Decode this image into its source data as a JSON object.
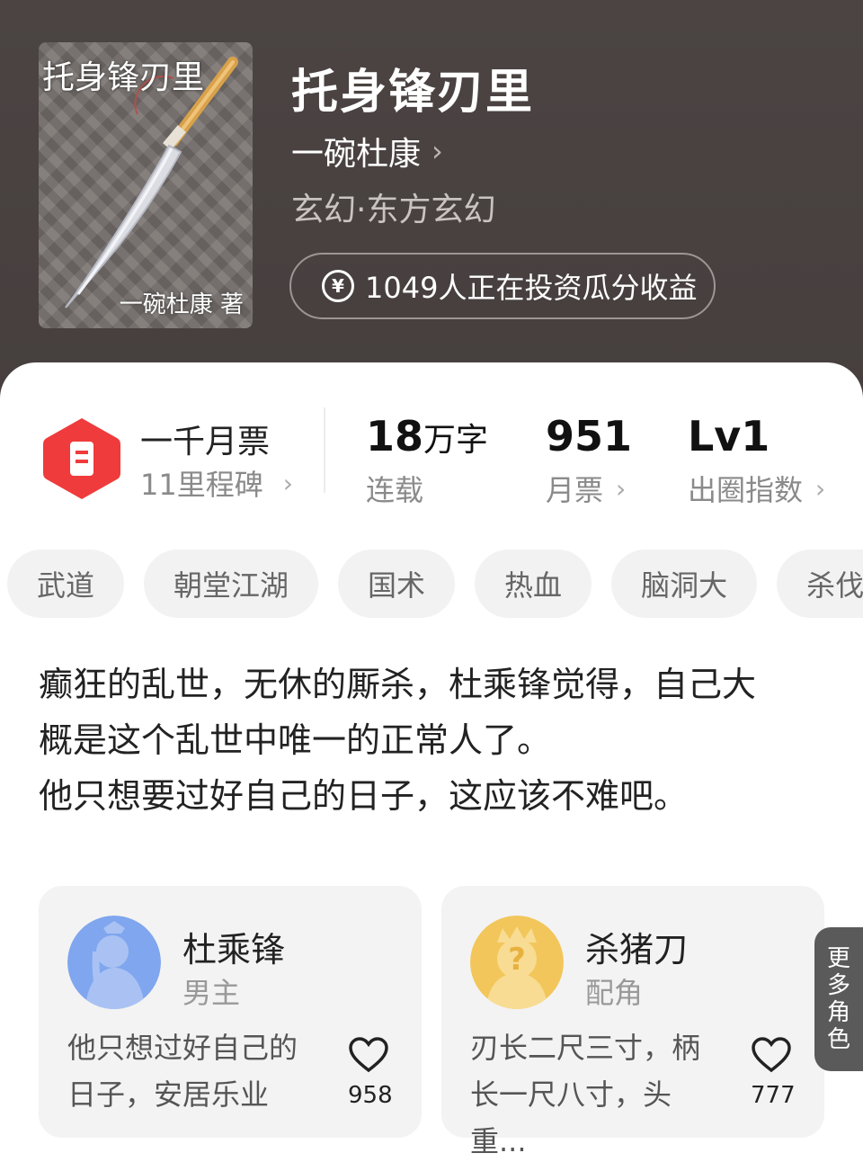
{
  "book": {
    "cover_title": "托身锋刃里",
    "cover_author": "一碗杜康 著",
    "title": "托身锋刃里",
    "author": "一碗杜康",
    "genre": "玄幻·东方玄幻",
    "invest_text": "1049人正在投资瓜分收益",
    "invest_icon": "yen-coin-icon"
  },
  "milestone": {
    "title": "一千月票",
    "sub": "11里程碑",
    "icon": "ticket-hexagon-icon",
    "color": "#ef3b3b"
  },
  "stats": [
    {
      "value": "18",
      "unit": "万字",
      "label": "连载"
    },
    {
      "value": "951",
      "unit": "",
      "label": "月票"
    },
    {
      "value": "Lv1",
      "unit": "",
      "label": "出圈指数"
    }
  ],
  "tags": [
    "武道",
    "朝堂江湖",
    "国术",
    "热血",
    "脑洞大",
    "杀伐果断"
  ],
  "description": [
    "癫狂的乱世，无休的厮杀，杜乘锋觉得，自己大",
    "概是这个乱世中唯一的正常人了。",
    "他只想要过好自己的日子，这应该不难吧。"
  ],
  "roles": [
    {
      "name": "杜乘锋",
      "tag": "男主",
      "desc_line1": "他只想过好自己的",
      "desc_line2": "日子，安居乐业",
      "likes": "958",
      "avatar_color": "#7fa6ee"
    },
    {
      "name": "杀猪刀",
      "tag": "配角",
      "desc_line1": "刃长二尺三寸，柄",
      "desc_line2": "长一尺八寸，头重...",
      "likes": "777",
      "avatar_color": "#f2c65a"
    }
  ],
  "more_roles": [
    "更",
    "多",
    "角",
    "色"
  ]
}
